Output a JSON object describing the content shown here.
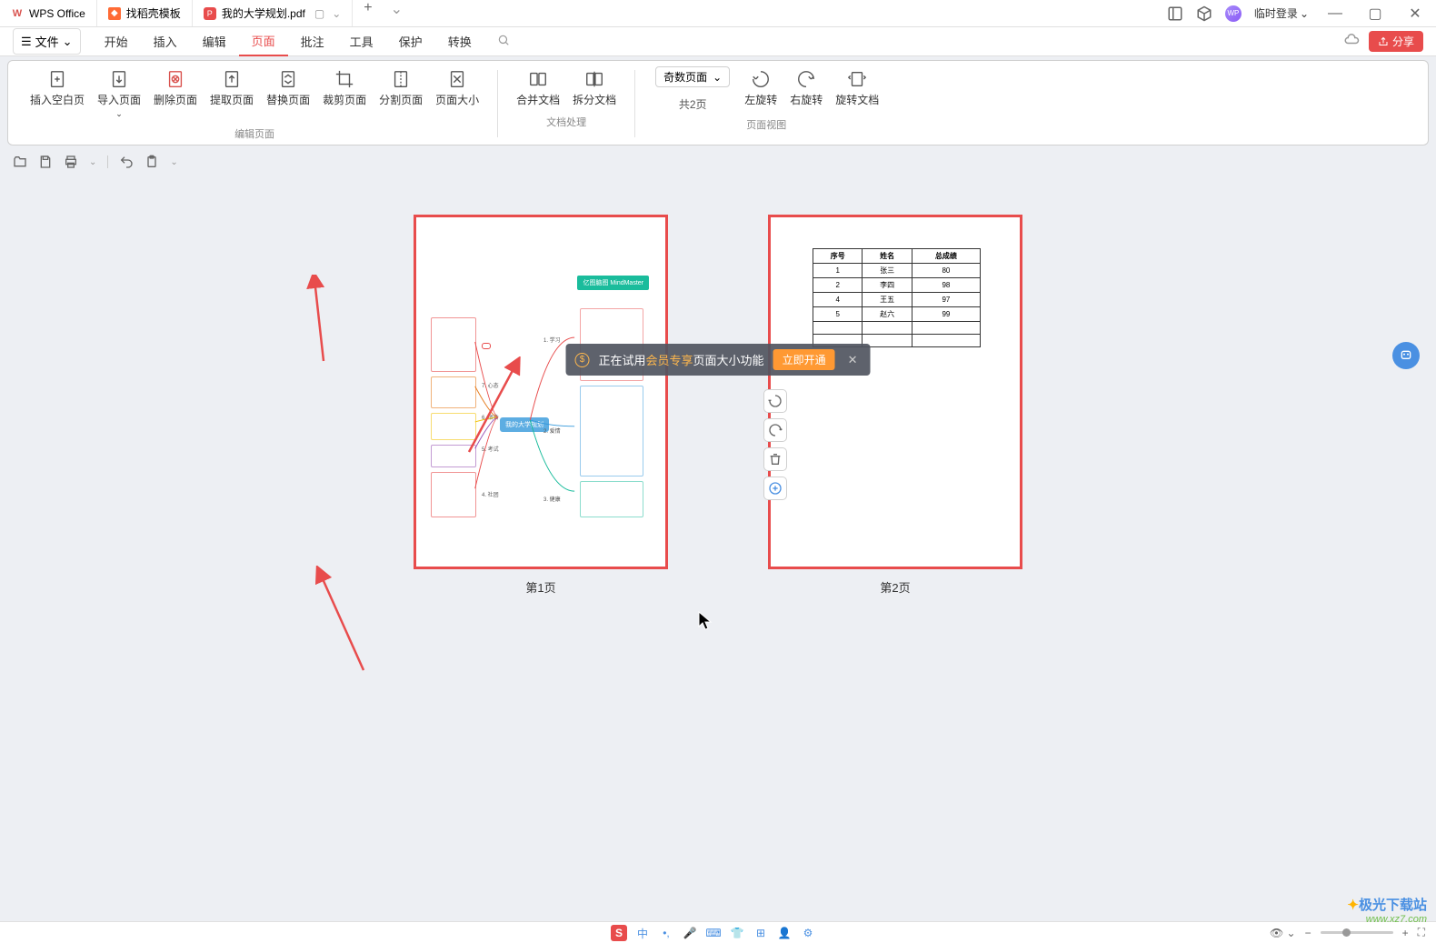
{
  "titlebar": {
    "tabs": [
      {
        "label": "WPS Office",
        "icon": "wps"
      },
      {
        "label": "找稻壳模板",
        "icon": "tmpl"
      },
      {
        "label": "我的大学规划.pdf",
        "icon": "pdf",
        "active": true
      }
    ],
    "login": "临时登录"
  },
  "menubar": {
    "file": "文件",
    "items": [
      "开始",
      "插入",
      "编辑",
      "页面",
      "批注",
      "工具",
      "保护",
      "转换"
    ],
    "active": "页面",
    "share": "分享"
  },
  "ribbon": {
    "edit": {
      "label": "编辑页面",
      "insert_blank": "插入空白页",
      "import": "导入页面",
      "delete": "删除页面",
      "extract": "提取页面",
      "replace": "替换页面",
      "crop": "裁剪页面",
      "split": "分割页面",
      "size": "页面大小"
    },
    "doc": {
      "label": "文档处理",
      "merge": "合并文档",
      "split": "拆分文档"
    },
    "view": {
      "label": "页面视图",
      "select": "奇数页面",
      "count": "共2页",
      "rotate_left": "左旋转",
      "rotate_right": "右旋转",
      "rotate_doc": "旋转文档"
    }
  },
  "alert": {
    "prefix": "正在试用",
    "highlight": "会员专享",
    "suffix": "页面大小功能",
    "btn": "立即开通"
  },
  "pages": {
    "p1_label": "第1页",
    "p2_label": "第2页",
    "mindmap_badge": "亿图脑图 MindMaster",
    "mindmap_center": "我的大学规划",
    "table": {
      "headers": [
        "序号",
        "姓名",
        "总成绩"
      ],
      "rows": [
        [
          "1",
          "张三",
          "80"
        ],
        [
          "2",
          "李四",
          "98"
        ],
        [
          "4",
          "王五",
          "97"
        ],
        [
          "5",
          "赵六",
          "99"
        ],
        [
          "",
          "",
          ""
        ],
        [
          "",
          "",
          ""
        ]
      ]
    }
  },
  "watermark": {
    "name": "极光下载站",
    "url": "www.xz7.com"
  }
}
